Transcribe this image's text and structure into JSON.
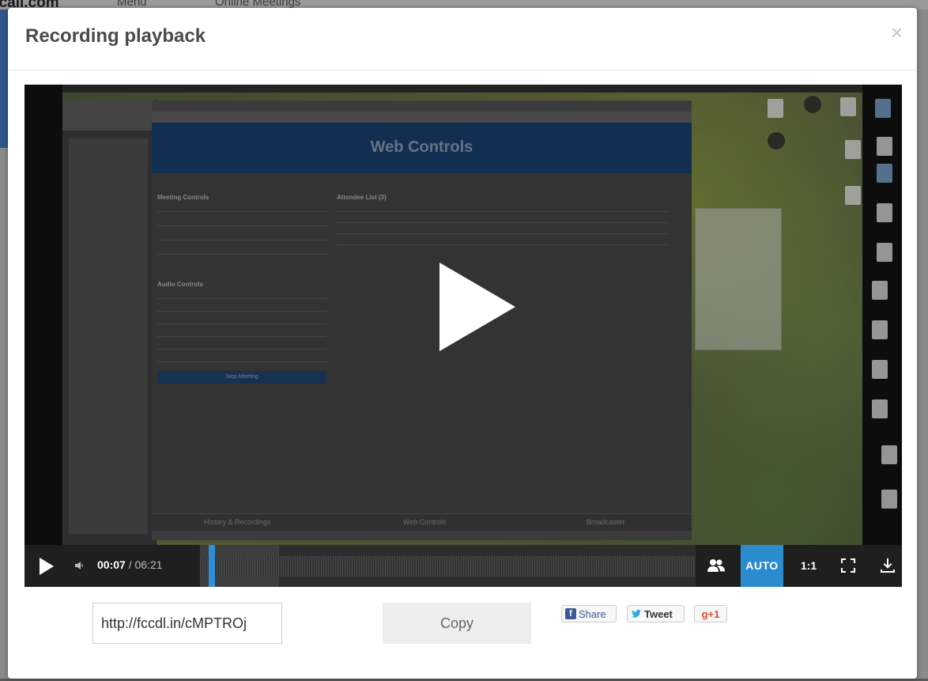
{
  "background": {
    "site_name": "ccall.com",
    "nav_items": [
      "Menu",
      "Online Meetings"
    ]
  },
  "modal": {
    "title": "Recording playback",
    "close_glyph": "×"
  },
  "video": {
    "screen_title": "Web Controls",
    "play_icon": "play-icon",
    "panels": {
      "meeting_controls": "Meeting Controls",
      "attendee_list": "Attendee List (3)",
      "audio_controls": "Audio Controls",
      "stop_meeting": "Stop Meeting"
    },
    "footer_tabs": [
      "History & Recordings",
      "Web Controls",
      "Broadcaster"
    ]
  },
  "player": {
    "current_time": "00:07",
    "separator": " / ",
    "total_time": "06:21",
    "progress_fraction": 0.018,
    "auto_label": "AUTO",
    "ratio_label": "1:1",
    "accent_color": "#2b8bcf"
  },
  "share": {
    "link_value": "http://fccdl.in/cMPTROj",
    "copy_label": "Copy",
    "facebook_label": "Share",
    "facebook_glyph": "f",
    "twitter_label": "Tweet",
    "gplus_label": "g+1"
  }
}
